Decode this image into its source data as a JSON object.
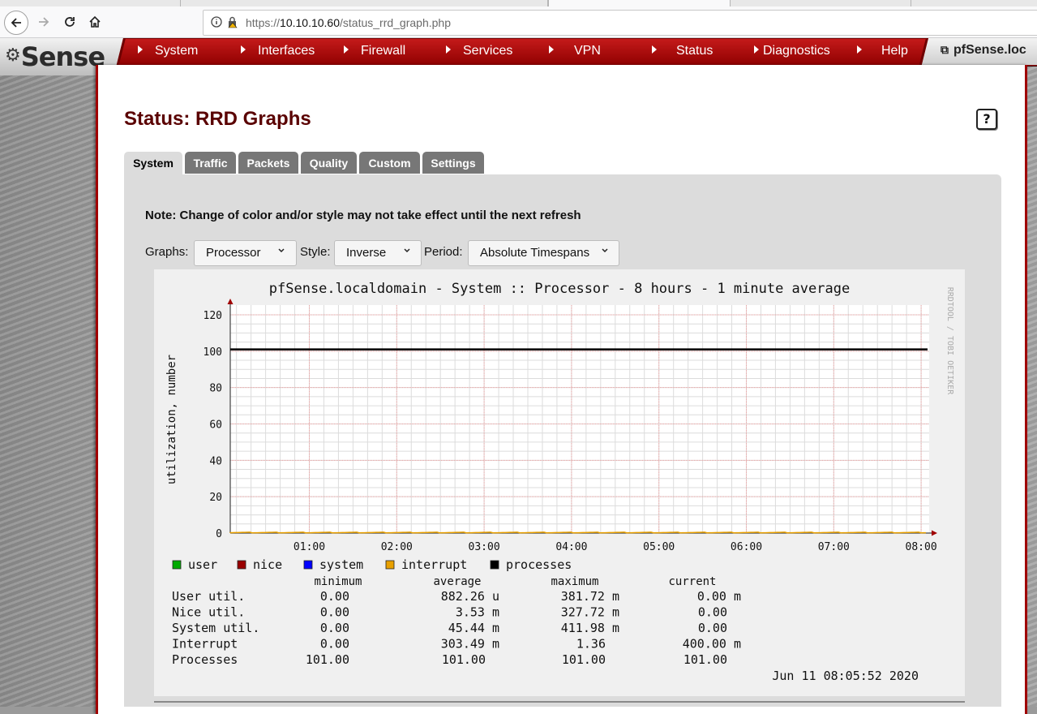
{
  "browser": {
    "url_prefix": "https://",
    "url_host": "10.10.10.60",
    "url_path": "/status_rrd_graph.php"
  },
  "menu": {
    "logo": "Sense",
    "items": [
      "System",
      "Interfaces",
      "Firewall",
      "Services",
      "VPN",
      "Status",
      "Diagnostics",
      "Help"
    ],
    "hostname": "pfSense.loc"
  },
  "page": {
    "title": "Status: RRD Graphs",
    "help": "?",
    "tabs": [
      "System",
      "Traffic",
      "Packets",
      "Quality",
      "Custom",
      "Settings"
    ],
    "note": "Note: Change of color and/or style may not take effect until the next refresh",
    "controls": {
      "graphs_label": "Graphs:",
      "graphs_value": "Processor",
      "style_label": "Style:",
      "style_value": "Inverse",
      "period_label": "Period:",
      "period_value": "Absolute Timespans"
    }
  },
  "chart_data": {
    "type": "line",
    "title": "pfSense.localdomain - System :: Processor - 8 hours - 1 minute average",
    "ylabel": "utilization, number",
    "side_label": "RRDTOOL / TOBI OETIKER",
    "ylim": [
      0,
      120
    ],
    "yticks": [
      0,
      20,
      40,
      60,
      80,
      100,
      120
    ],
    "xticks": [
      "01:00",
      "02:00",
      "03:00",
      "04:00",
      "05:00",
      "06:00",
      "07:00",
      "08:00"
    ],
    "series": [
      {
        "name": "user",
        "color": "#00aa00",
        "value": 0.0
      },
      {
        "name": "nice",
        "color": "#990000",
        "value": 0.0
      },
      {
        "name": "system",
        "color": "#0000ff",
        "value": 0.0
      },
      {
        "name": "interrupt",
        "color": "#e8a000",
        "value": 0.4
      },
      {
        "name": "processes",
        "color": "#000000",
        "value": 101
      }
    ],
    "table": {
      "headers": [
        "minimum",
        "average",
        "maximum",
        "current"
      ],
      "rows": [
        {
          "label": "User util.",
          "cells": [
            "0.00",
            "882.26 u",
            "381.72 m",
            "0.00 m"
          ]
        },
        {
          "label": "Nice util.",
          "cells": [
            "0.00",
            "3.53 m",
            "327.72 m",
            "0.00"
          ]
        },
        {
          "label": "System util.",
          "cells": [
            "0.00",
            "45.44 m",
            "411.98 m",
            "0.00"
          ]
        },
        {
          "label": "Interrupt",
          "cells": [
            "0.00",
            "303.49 m",
            "1.36",
            "400.00 m"
          ]
        },
        {
          "label": "Processes",
          "cells": [
            "101.00",
            "101.00",
            "101.00",
            "101.00"
          ]
        }
      ]
    },
    "timestamp": "Jun 11 08:05:52 2020"
  }
}
